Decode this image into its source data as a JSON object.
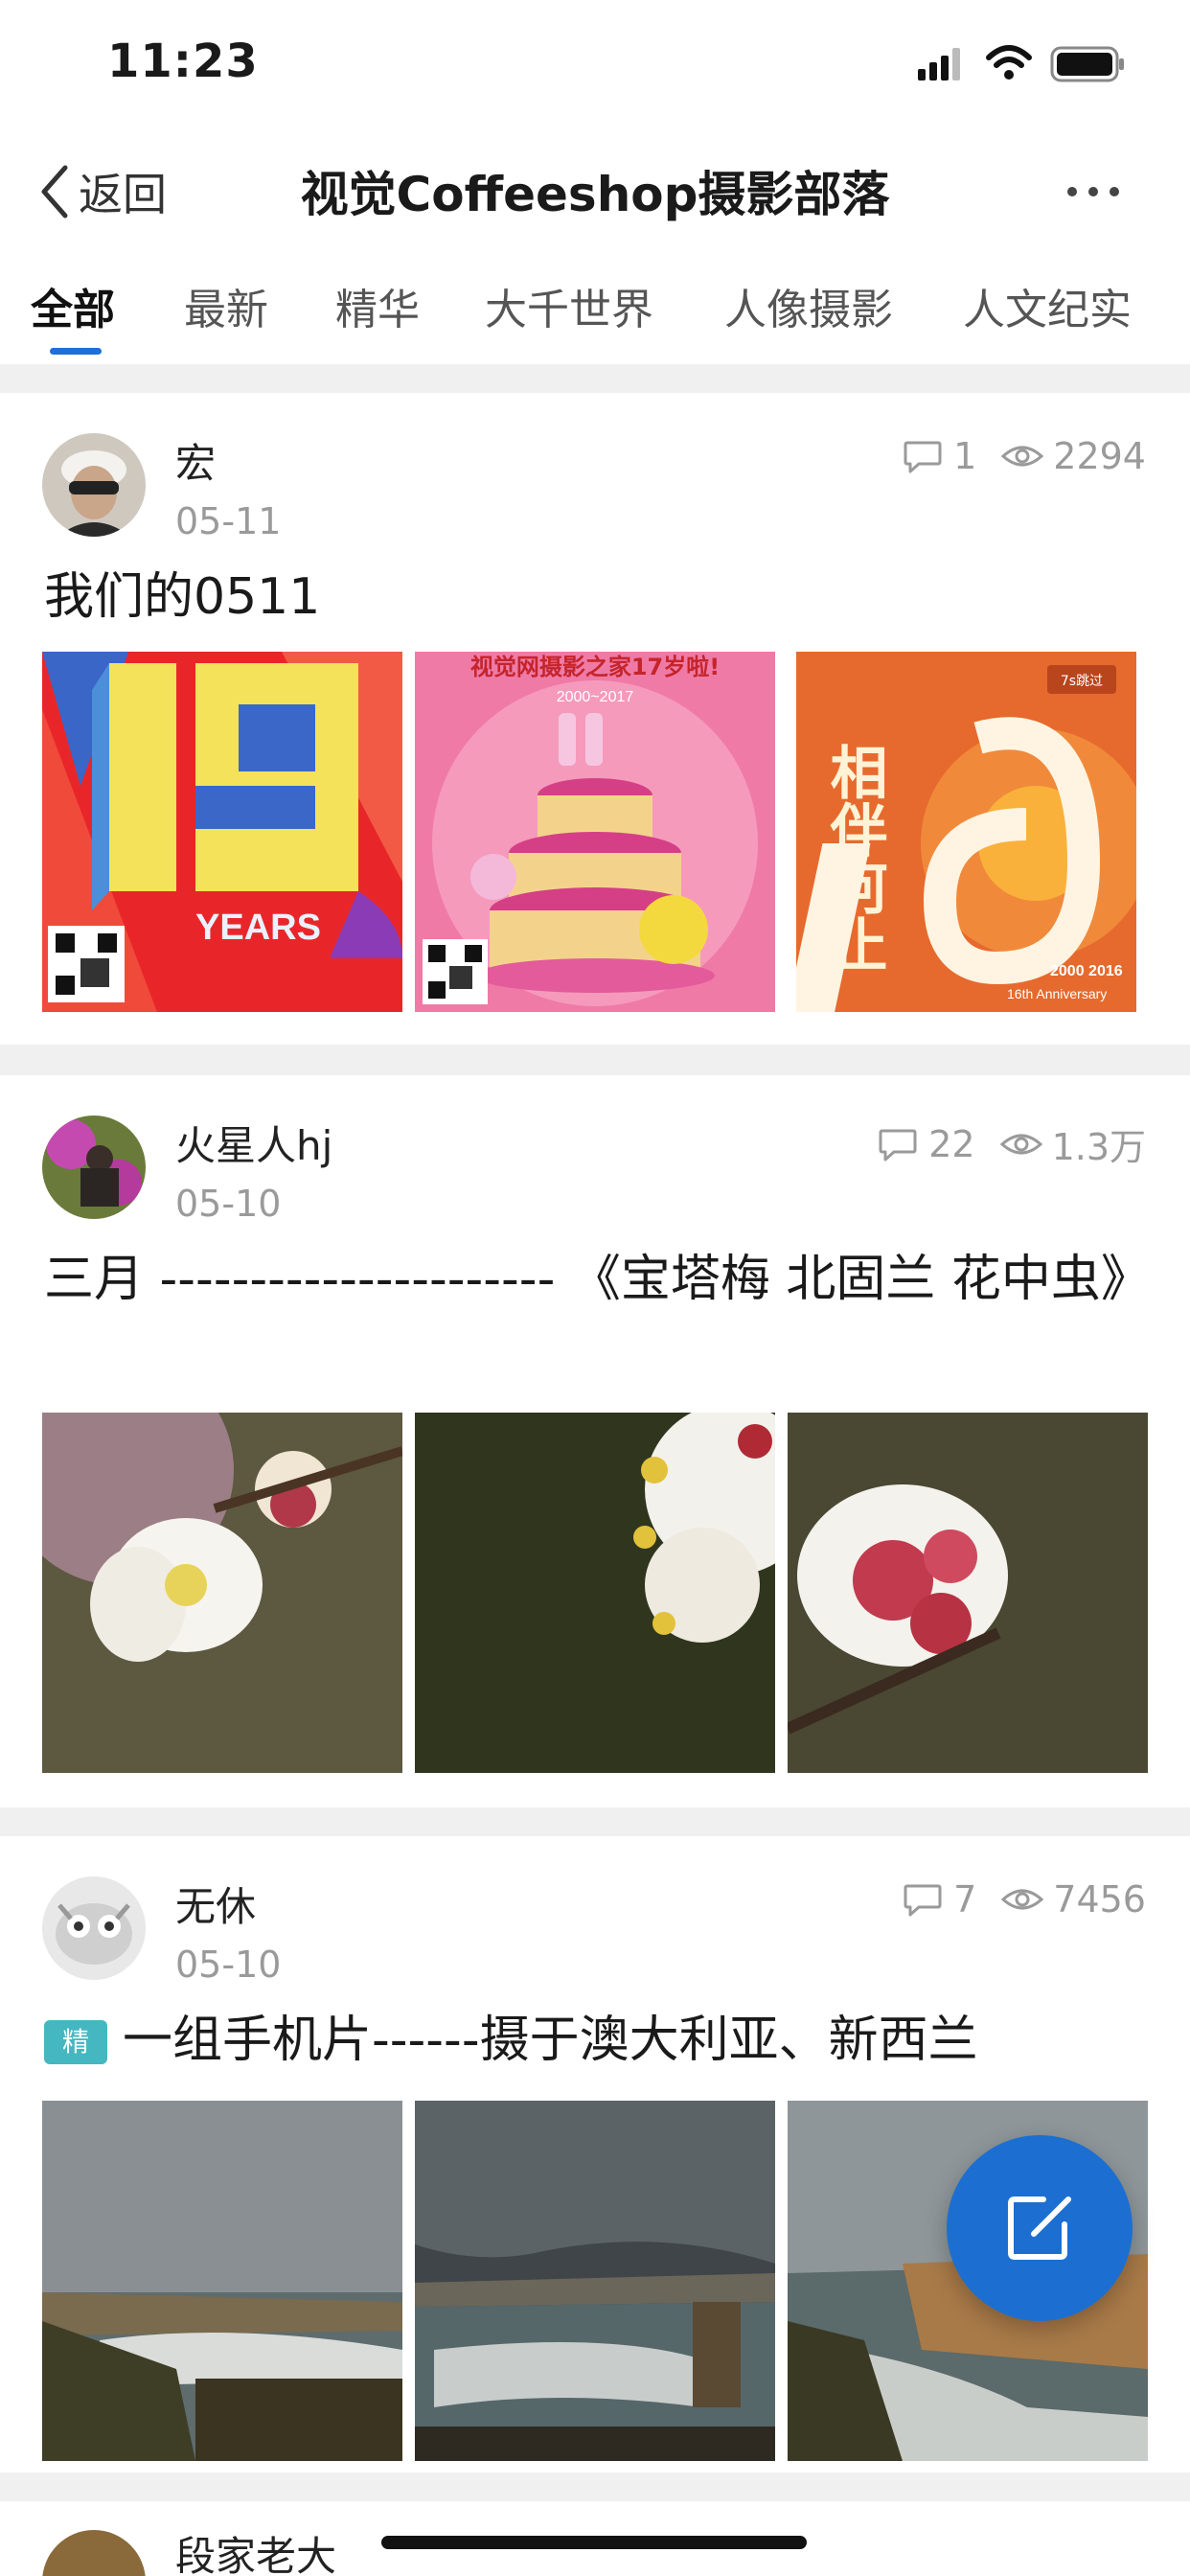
{
  "status_bar": {
    "time": "11:23"
  },
  "nav": {
    "back_label": "返回",
    "title": "视觉Coffeeshop摄影部落",
    "more_icon": "more-dots-icon"
  },
  "tabs": [
    {
      "label": "全部",
      "active": true
    },
    {
      "label": "最新"
    },
    {
      "label": "精华"
    },
    {
      "label": "大千世界"
    },
    {
      "label": "人像摄影"
    },
    {
      "label": "人文纪实"
    }
  ],
  "posts": [
    {
      "author": "宏",
      "date": "05-11",
      "comments": "1",
      "views": "2294",
      "title": "我们的0511",
      "images": [
        "anniversary-19-years",
        "anniversary-cake-17",
        "anniversary-16"
      ],
      "image_texts": {
        "years": "YEARS",
        "cake_banner": "视觉网摄影之家17岁啦!",
        "cake_years": "2000~2017",
        "skip": "7s跳过",
        "slogan": "相伴何止",
        "ann_years": "2000 2016",
        "ann_label": "16th Anniversary"
      }
    },
    {
      "author": "火星人hj",
      "date": "05-10",
      "comments": "22",
      "views": "1.3万",
      "title": "三月 ---------------------- 《宝塔梅 北固兰 花中虫》",
      "images": [
        "plum-blossom-1",
        "plum-blossom-2",
        "plum-blossom-3"
      ]
    },
    {
      "author": "无休",
      "date": "05-10",
      "comments": "7",
      "views": "7456",
      "badge": "精",
      "title": "一组手机片------摄于澳大利亚、新西兰",
      "images": [
        "coast-1",
        "coast-2",
        "coast-3"
      ]
    },
    {
      "author": "段家老大"
    }
  ],
  "fab_icon": "compose-icon",
  "colors": {
    "accent": "#1e6fd9",
    "badge": "#45b7c0",
    "fab": "#1c6fd1"
  }
}
